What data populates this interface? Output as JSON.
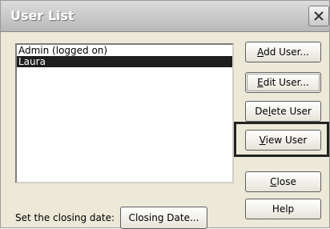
{
  "window": {
    "title": "User List"
  },
  "users": [
    "Admin (logged on)",
    "Laura"
  ],
  "selected_user": "Laura",
  "buttons": {
    "add_user": {
      "pre": "",
      "key": "A",
      "post": "dd User..."
    },
    "edit_user": {
      "pre": "",
      "key": "E",
      "post": "dit User..."
    },
    "delete_user": {
      "pre": "De",
      "key": "l",
      "post": "ete User"
    },
    "view_user": {
      "pre": "",
      "key": "V",
      "post": "iew User"
    },
    "close": {
      "pre": "",
      "key": "C",
      "post": "lose"
    },
    "help": "Help",
    "closing_date": "Closing Date..."
  },
  "closing_label": "Set the closing date:"
}
